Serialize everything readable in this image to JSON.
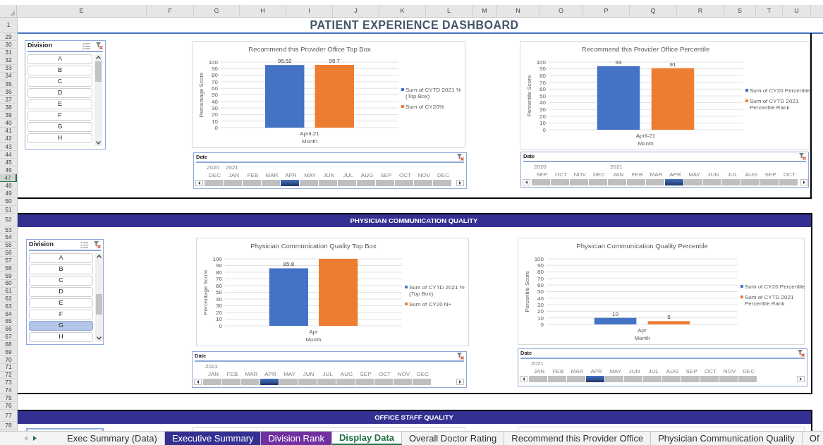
{
  "columns": [
    "E",
    "F",
    "G",
    "H",
    "I",
    "J",
    "K",
    "L",
    "M",
    "N",
    "O",
    "P",
    "Q",
    "R",
    "S",
    "T",
    "U"
  ],
  "rows": [
    {
      "label": "1",
      "selected": false
    },
    {
      "label": "29",
      "selected": false
    },
    {
      "label": "30",
      "selected": false
    },
    {
      "label": "31",
      "selected": false
    },
    {
      "label": "32",
      "selected": false
    },
    {
      "label": "33",
      "selected": false
    },
    {
      "label": "34",
      "selected": false
    },
    {
      "label": "35",
      "selected": false
    },
    {
      "label": "36",
      "selected": false
    },
    {
      "label": "37",
      "selected": false
    },
    {
      "label": "38",
      "selected": false
    },
    {
      "label": "39",
      "selected": false
    },
    {
      "label": "40",
      "selected": false
    },
    {
      "label": "41",
      "selected": false
    },
    {
      "label": "42",
      "selected": false
    },
    {
      "label": "43",
      "selected": false
    },
    {
      "label": "44",
      "selected": false
    },
    {
      "label": "45",
      "selected": false
    },
    {
      "label": "46",
      "selected": false
    },
    {
      "label": "47",
      "selected": true
    },
    {
      "label": "48",
      "selected": false
    },
    {
      "label": "49",
      "selected": false
    },
    {
      "label": "50",
      "selected": false
    },
    {
      "label": "51",
      "selected": false
    },
    {
      "label": "52",
      "selected": false
    },
    {
      "label": "53",
      "selected": false
    },
    {
      "label": "54",
      "selected": false
    },
    {
      "label": "55",
      "selected": false
    },
    {
      "label": "56",
      "selected": false
    },
    {
      "label": "57",
      "selected": false
    },
    {
      "label": "58",
      "selected": false
    },
    {
      "label": "59",
      "selected": false
    },
    {
      "label": "60",
      "selected": false
    },
    {
      "label": "61",
      "selected": false
    },
    {
      "label": "62",
      "selected": false
    },
    {
      "label": "63",
      "selected": false
    },
    {
      "label": "64",
      "selected": false
    },
    {
      "label": "65",
      "selected": false
    },
    {
      "label": "66",
      "selected": false
    },
    {
      "label": "67",
      "selected": false
    },
    {
      "label": "68",
      "selected": false
    },
    {
      "label": "69",
      "selected": false
    },
    {
      "label": "70",
      "selected": false
    },
    {
      "label": "71",
      "selected": false
    },
    {
      "label": "72",
      "selected": false
    },
    {
      "label": "73",
      "selected": false
    },
    {
      "label": "74",
      "selected": false
    },
    {
      "label": "75",
      "selected": false
    },
    {
      "label": "76",
      "selected": false
    },
    {
      "label": "77",
      "selected": false
    },
    {
      "label": "78",
      "selected": false
    }
  ],
  "title": "PATIENT EXPERIENCE DASHBOARD",
  "sections": [
    {
      "slicer": {
        "title": "Division",
        "items": [
          {
            "label": "A",
            "selected": false
          },
          {
            "label": "B",
            "selected": false
          },
          {
            "label": "C",
            "selected": false
          },
          {
            "label": "D",
            "selected": false
          },
          {
            "label": "E",
            "selected": false
          },
          {
            "label": "F",
            "selected": false
          },
          {
            "label": "G",
            "selected": false
          },
          {
            "label": "H",
            "selected": false
          }
        ]
      },
      "panels": [
        {
          "chart_data": {
            "type": "bar",
            "title": "Recommend this Provider Office Top Box",
            "xlabel": "Month",
            "ylabel": "Percentage Score",
            "categories": [
              "April-21"
            ],
            "series": [
              {
                "name": "Sum of CYTD 2021 % (Top Box)",
                "color": "#4472c4",
                "values": [
                  95.52
                ]
              },
              {
                "name": "Sum of CY20%",
                "color": "#ed7d31",
                "values": [
                  95.7
                ]
              }
            ],
            "ylim": [
              0,
              100
            ],
            "yticks": [
              0,
              10,
              20,
              30,
              40,
              50,
              60,
              70,
              80,
              90,
              100
            ],
            "value_labels": [
              [
                "95.52"
              ],
              [
                "95.7"
              ]
            ],
            "grid": true,
            "legend": true
          },
          "timeline": {
            "title": "Date",
            "months": [
              {
                "label": "DEC",
                "year": "2020",
                "selected": false
              },
              {
                "label": "JAN",
                "year": "2021",
                "selected": false
              },
              {
                "label": "FEB",
                "selected": false
              },
              {
                "label": "MAR",
                "selected": false
              },
              {
                "label": "APR",
                "selected": true
              },
              {
                "label": "MAY",
                "selected": false
              },
              {
                "label": "JUN",
                "selected": false
              },
              {
                "label": "JUL",
                "selected": false
              },
              {
                "label": "AUG",
                "selected": false
              },
              {
                "label": "SEP",
                "selected": false
              },
              {
                "label": "OCT",
                "selected": false
              },
              {
                "label": "NOV",
                "selected": false
              },
              {
                "label": "DEC",
                "selected": false
              }
            ]
          }
        },
        {
          "chart_data": {
            "type": "bar",
            "title": "Recommend this Provider Office Percentile",
            "xlabel": "Month",
            "ylabel": "Percentile Score",
            "categories": [
              "April-21"
            ],
            "series": [
              {
                "name": "Sum of CY20 Percentile",
                "color": "#4472c4",
                "values": [
                  94
                ]
              },
              {
                "name": "Sum of CYTD 2021 Percentile Rank",
                "color": "#ed7d31",
                "values": [
                  91
                ]
              }
            ],
            "ylim": [
              0,
              100
            ],
            "yticks": [
              0,
              10,
              20,
              30,
              40,
              50,
              60,
              70,
              80,
              90,
              100
            ],
            "value_labels": [
              [
                "94"
              ],
              [
                "91"
              ]
            ],
            "grid": true,
            "legend": true
          },
          "timeline": {
            "title": "Date",
            "months": [
              {
                "label": "SEP",
                "year": "2020",
                "selected": false
              },
              {
                "label": "OCT",
                "selected": false
              },
              {
                "label": "NOV",
                "selected": false
              },
              {
                "label": "DEC",
                "selected": false
              },
              {
                "label": "JAN",
                "year": "2021",
                "selected": false
              },
              {
                "label": "FEB",
                "selected": false
              },
              {
                "label": "MAR",
                "selected": false
              },
              {
                "label": "APR",
                "selected": true
              },
              {
                "label": "MAY",
                "selected": false
              },
              {
                "label": "JUN",
                "selected": false
              },
              {
                "label": "JUL",
                "selected": false
              },
              {
                "label": "AUG",
                "selected": false
              },
              {
                "label": "SEP",
                "selected": false
              },
              {
                "label": "OCT",
                "selected": false
              }
            ]
          }
        }
      ]
    },
    {
      "heading": "PHYSICIAN COMMUNICATION QUALITY",
      "slicer": {
        "title": "Division",
        "items": [
          {
            "label": "A",
            "selected": false
          },
          {
            "label": "B",
            "selected": false
          },
          {
            "label": "C",
            "selected": false
          },
          {
            "label": "D",
            "selected": false
          },
          {
            "label": "E",
            "selected": false
          },
          {
            "label": "F",
            "selected": false
          },
          {
            "label": "G",
            "selected": true
          },
          {
            "label": "H",
            "selected": false
          }
        ]
      },
      "panels": [
        {
          "chart_data": {
            "type": "bar",
            "title": "Physician Communication Quality Top Box",
            "xlabel": "Month",
            "ylabel": "Percentage Score",
            "categories": [
              "Apr"
            ],
            "series": [
              {
                "name": "Sum of CYTD 2021 % (Top Box)",
                "color": "#4472c4",
                "values": [
                  85.8
                ]
              },
              {
                "name": "Sum of CY20 N+",
                "color": "#ed7d31",
                "values": [
                  100
                ]
              }
            ],
            "ylim": [
              0,
              100
            ],
            "yticks": [
              0,
              10,
              20,
              30,
              40,
              50,
              60,
              70,
              80,
              90,
              100
            ],
            "value_labels": [
              [
                "85.8"
              ],
              [
                null
              ]
            ],
            "grid": true,
            "legend": true
          },
          "timeline": {
            "title": "Date",
            "months": [
              {
                "label": "JAN",
                "year": "2021",
                "selected": false
              },
              {
                "label": "FEB",
                "selected": false
              },
              {
                "label": "MAR",
                "selected": false
              },
              {
                "label": "APR",
                "selected": true
              },
              {
                "label": "MAY",
                "selected": false
              },
              {
                "label": "JUN",
                "selected": false
              },
              {
                "label": "JUL",
                "selected": false
              },
              {
                "label": "AUG",
                "selected": false
              },
              {
                "label": "SEP",
                "selected": false
              },
              {
                "label": "OCT",
                "selected": false
              },
              {
                "label": "NOV",
                "selected": false
              },
              {
                "label": "DEC",
                "selected": false
              }
            ]
          }
        },
        {
          "chart_data": {
            "type": "bar",
            "title": "Physician Communication Quality Percentile",
            "xlabel": "Month",
            "ylabel": "Percentile Score",
            "categories": [
              "Apr"
            ],
            "series": [
              {
                "name": "Sum of CY20 Percentile",
                "color": "#4472c4",
                "values": [
                  10
                ]
              },
              {
                "name": "Sum of CYTD 2021 Percentile Rank",
                "color": "#ed7d31",
                "values": [
                  5
                ]
              }
            ],
            "ylim": [
              0,
              100
            ],
            "yticks": [
              0,
              10,
              20,
              30,
              40,
              50,
              60,
              70,
              80,
              90,
              100
            ],
            "value_labels": [
              [
                "10"
              ],
              [
                "5"
              ]
            ],
            "grid": true,
            "legend": true
          },
          "timeline": {
            "title": "Date",
            "months": [
              {
                "label": "JAN",
                "year": "2021",
                "selected": false
              },
              {
                "label": "FEB",
                "selected": false
              },
              {
                "label": "MAR",
                "selected": false
              },
              {
                "label": "APR",
                "selected": true
              },
              {
                "label": "MAY",
                "selected": false
              },
              {
                "label": "JUN",
                "selected": false
              },
              {
                "label": "JUL",
                "selected": false
              },
              {
                "label": "AUG",
                "selected": false
              },
              {
                "label": "SEP",
                "selected": false
              },
              {
                "label": "OCT",
                "selected": false
              },
              {
                "label": "NOV",
                "selected": false
              },
              {
                "label": "DEC",
                "selected": false
              }
            ]
          }
        }
      ]
    },
    {
      "heading": "OFFICE STAFF QUALITY"
    }
  ],
  "sheet_tabs": [
    {
      "label": "Exec Summary (Data)",
      "selected": false
    },
    {
      "label": "Executive Summary",
      "selected": false,
      "color": "#333092"
    },
    {
      "label": "Division Rank",
      "selected": false,
      "color": "#7030a0"
    },
    {
      "label": "Display Data",
      "selected": true
    },
    {
      "label": "Overall Doctor Rating",
      "selected": false
    },
    {
      "label": "Recommend this Provider Office",
      "selected": false
    },
    {
      "label": "Physician Communication Quality",
      "selected": false
    },
    {
      "label": "Of",
      "selected": false
    }
  ]
}
